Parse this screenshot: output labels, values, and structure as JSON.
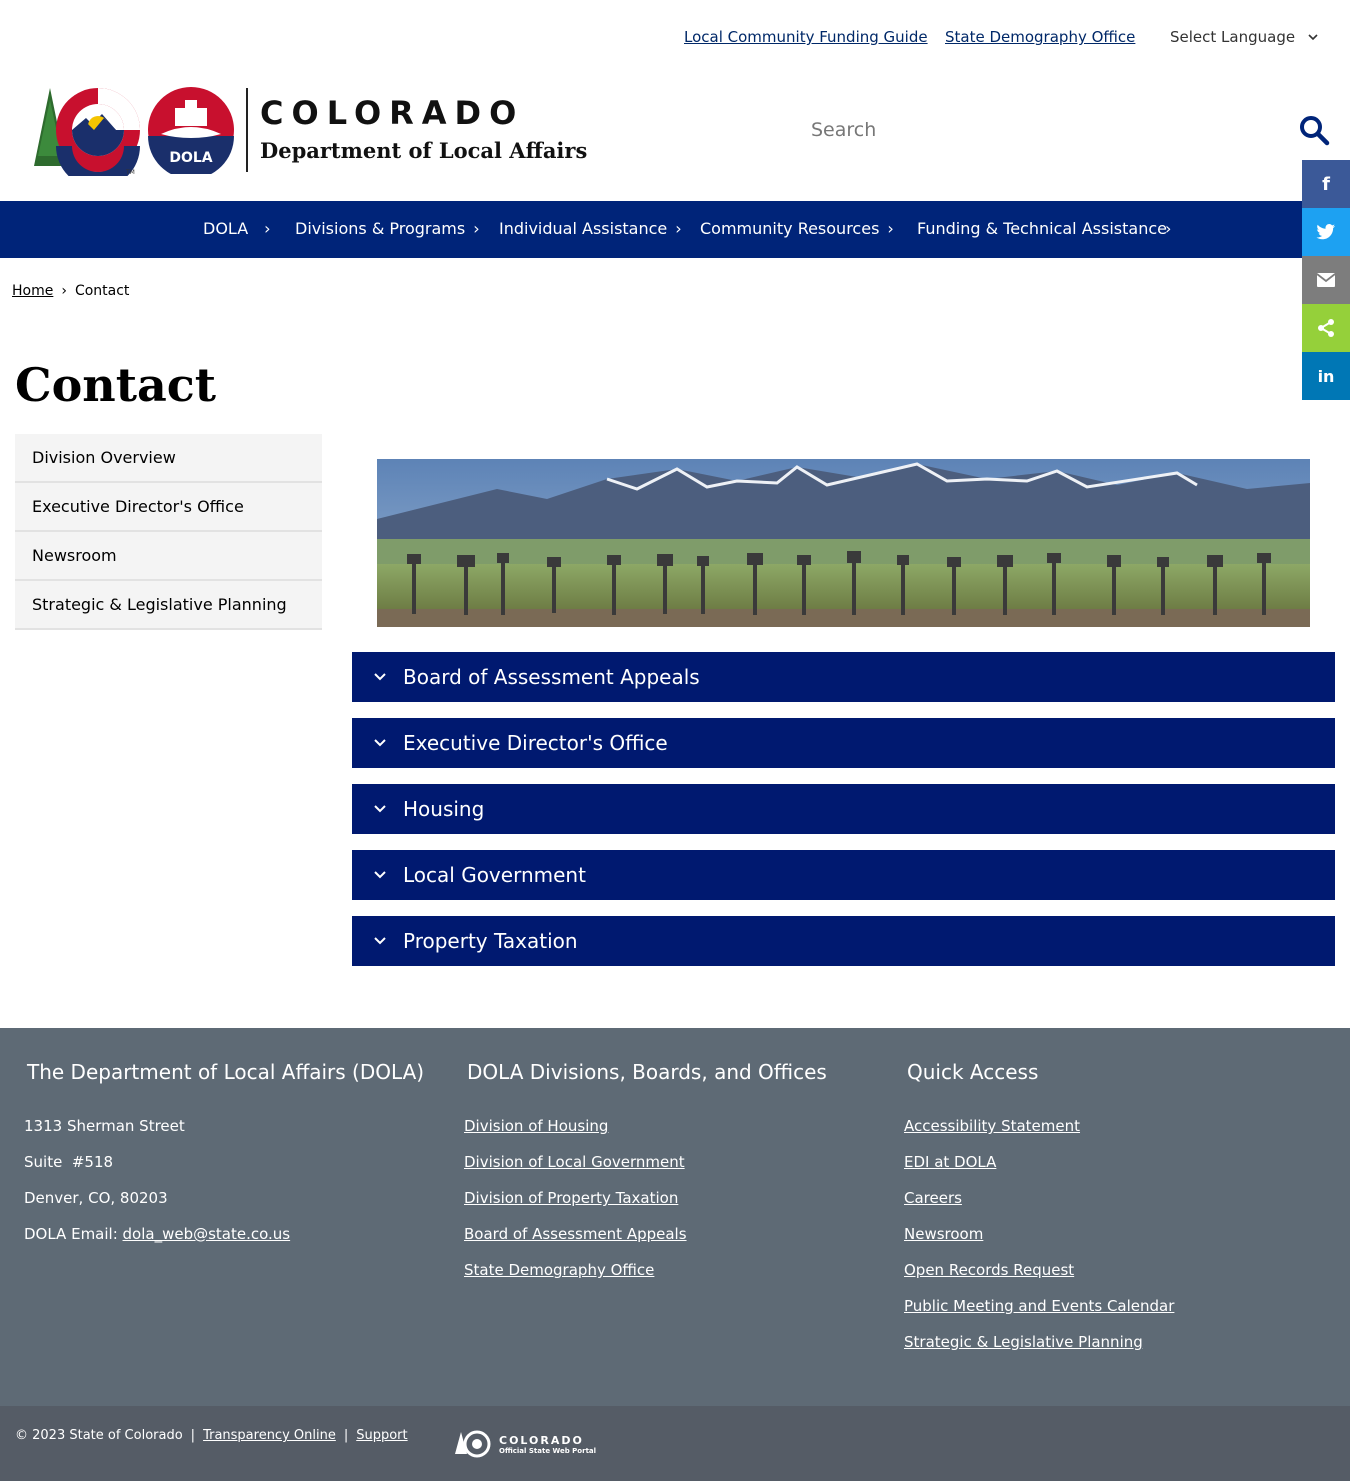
{
  "utility": {
    "link1": "Local Community Funding Guide",
    "link2": "State Demography Office",
    "language": "Select Language"
  },
  "header": {
    "title": "COLORADO",
    "subtitle": "Department of Local Affairs",
    "logo_badge": "DOLA",
    "search_placeholder": "Search"
  },
  "nav": [
    {
      "label": "DOLA"
    },
    {
      "label": "Divisions & Programs"
    },
    {
      "label": "Individual Assistance"
    },
    {
      "label": "Community Resources"
    },
    {
      "label": "Funding & Technical Assistance"
    }
  ],
  "share": {
    "facebook_icon": "f",
    "linkedin_icon": "in",
    "colors": {
      "facebook": "#3b5998",
      "twitter": "#1da1f2",
      "email": "#7d7d7d",
      "share": "#95d03a",
      "linkedin": "#0077b5"
    }
  },
  "breadcrumb": {
    "home": "Home",
    "current": "Contact"
  },
  "page_title": "Contact",
  "sidenav": [
    {
      "label": "Division Overview"
    },
    {
      "label": "Executive Director's Office"
    },
    {
      "label": "Newsroom"
    },
    {
      "label": "Strategic & Legislative Planning"
    }
  ],
  "accordions": [
    {
      "label": "Board of Assessment Appeals"
    },
    {
      "label": "Executive Director's Office"
    },
    {
      "label": "Housing"
    },
    {
      "label": "Local Government"
    },
    {
      "label": "Property Taxation"
    }
  ],
  "footer": {
    "col1": {
      "heading": "The Department of Local Affairs (DOLA)",
      "address1": "1313 Sherman Street",
      "address2": "Suite  #518",
      "address3": "Denver, CO, 80203",
      "email_label": "DOLA Email: ",
      "email": "dola_web@state.co.us"
    },
    "col2": {
      "heading": "DOLA Divisions, Boards, and Offices",
      "links": [
        "Division of Housing",
        "Division of Local Government",
        "Division of Property Taxation",
        "Board of Assessment Appeals",
        "State Demography Office"
      ]
    },
    "col3": {
      "heading": "Quick Access",
      "links": [
        "Accessibility Statement",
        "EDI at DOLA",
        "Careers",
        "Newsroom",
        "Open Records Request",
        "Public Meeting and Events Calendar",
        "Strategic & Legislative Planning"
      ]
    }
  },
  "bottom": {
    "copyright": "© 2023 State of Colorado",
    "sep": "|",
    "transparency": "Transparency Online",
    "support": "Support",
    "portal_title": "COLORADO",
    "portal_sub": "Official State Web Portal"
  },
  "colors": {
    "nav": "#002479",
    "accordion": "#001970",
    "footer": "#5e6a75",
    "bottom": "#555c66",
    "link": "#002868"
  }
}
